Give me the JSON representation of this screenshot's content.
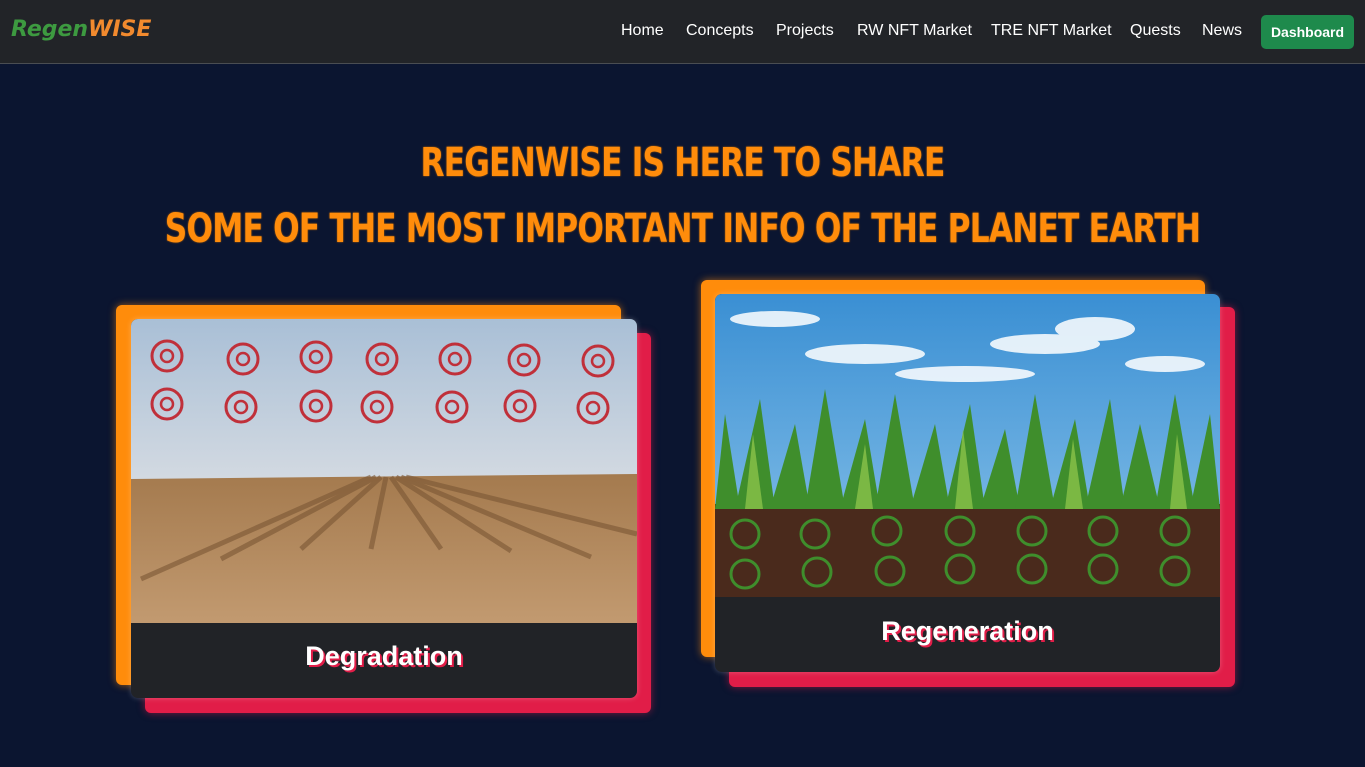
{
  "brand": {
    "part1": "Regen",
    "part2": "WISE"
  },
  "nav": {
    "items": [
      "Home",
      "Concepts",
      "Projects",
      "RW NFT Market",
      "TRE NFT Market",
      "Quests",
      "News"
    ],
    "dashboard_label": "Dashboard"
  },
  "hero": {
    "line1": "REGENWISE IS HERE TO SHARE",
    "line2": "SOME OF THE MOST IMPORTANT INFO  OF THE PLANET EARTH"
  },
  "cards": [
    {
      "title": "Degradation",
      "image": "degraded-farmland-painting"
    },
    {
      "title": "Regeneration",
      "image": "regenerated-plants-painting"
    }
  ],
  "colors": {
    "background": "#0b1530",
    "navbar": "#222428",
    "accent_orange": "#ff8c0b",
    "accent_red": "#e11d48",
    "dashboard_green": "#1e8a4c",
    "brand_green": "#3d9a40"
  }
}
